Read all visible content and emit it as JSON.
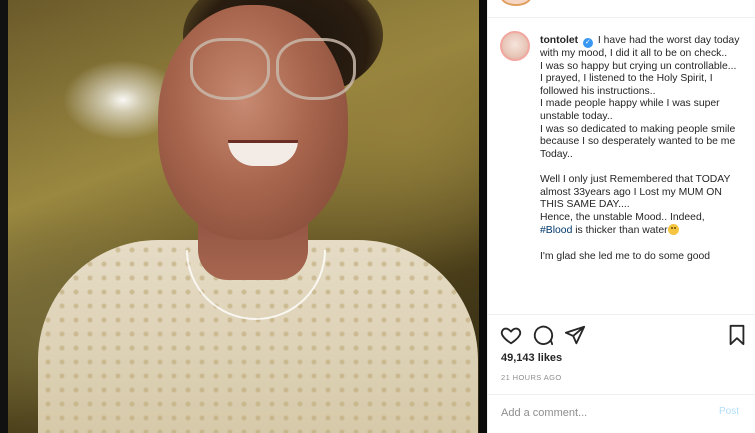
{
  "post": {
    "username": "tontolet",
    "verified": true,
    "caption_lines": [
      "I have had the worst day today with my mood, I did it all to be on check..",
      "I was so happy but crying un controllable...",
      "I prayed, I listened to the Holy Spirit, I followed his instructions..",
      "I made people happy while I was super unstable today..",
      "I was so dedicated to making people smile because I so desperately wanted to be me Today..",
      "",
      "Well I only just Remembered that TODAY almost 33years ago I Lost my MUM ON THIS SAME DAY....",
      "Hence, the unstable Mood.. Indeed,"
    ],
    "hashtag": "#Blood",
    "hashtag_tail": " is thicker than water",
    "last_line": "I'm glad she led me to do some good",
    "likes": "49,143 likes",
    "time_ago": "21 HOURS AGO"
  },
  "actions": {
    "like_icon": "heart-icon",
    "comment_icon": "comment-icon",
    "share_icon": "share-icon",
    "save_icon": "bookmark-icon"
  },
  "comment_box": {
    "placeholder": "Add a comment...",
    "post_label": "Post"
  },
  "colors": {
    "link": "#00376b",
    "verified": "#3897f0",
    "post_disabled": "#b2dffc",
    "muted": "#8e8e8e"
  }
}
